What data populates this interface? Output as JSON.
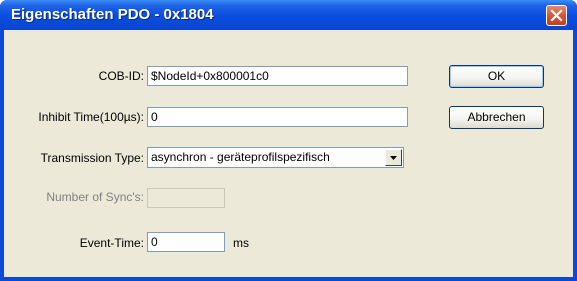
{
  "window": {
    "title": "Eigenschaften PDO - 0x1804"
  },
  "form": {
    "cob_id": {
      "label": "COB-ID:",
      "value": "$NodeId+0x800001c0"
    },
    "inhibit_time": {
      "label": "Inhibit Time(100µs):",
      "value": "0"
    },
    "transmission_type": {
      "label": "Transmission Type:",
      "value": "asynchron - geräteprofilspezifisch"
    },
    "number_of_syncs": {
      "label": "Number of Sync's:",
      "value": ""
    },
    "event_time": {
      "label": "Event-Time:",
      "value": "0",
      "unit": "ms"
    }
  },
  "buttons": {
    "ok": "OK",
    "cancel": "Abbrechen"
  },
  "icons": {
    "close": "close-icon",
    "dropdown": "chevron-down-icon"
  },
  "colors": {
    "titlebar": "#0b4fe0",
    "client": "#ece9d8",
    "close_button": "#d8553a"
  }
}
